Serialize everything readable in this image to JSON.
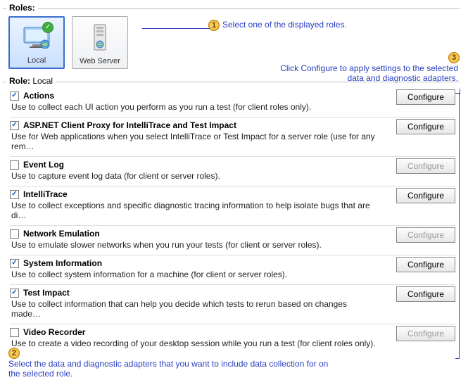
{
  "rolesHeader": "Roles:",
  "roles": [
    {
      "label": "Local",
      "selected": true
    },
    {
      "label": "Web Server",
      "selected": false
    }
  ],
  "roleDetailPrefix": "Role:",
  "roleDetailName": "Local",
  "adapters": [
    {
      "title": "Actions",
      "desc": "Use to collect each UI action you perform as you run a test (for client roles only).",
      "checked": true,
      "enabled": true
    },
    {
      "title": "ASP.NET Client Proxy for IntelliTrace and Test Impact",
      "desc": "Use for Web applications when you select IntelliTrace or Test Impact for a server role (use for any rem…",
      "checked": true,
      "enabled": true
    },
    {
      "title": "Event Log",
      "desc": "Use to capture event log data (for client or server roles).",
      "checked": false,
      "enabled": false
    },
    {
      "title": "IntelliTrace",
      "desc": "Use to collect exceptions and specific diagnostic tracing information to help isolate bugs that are di…",
      "checked": true,
      "enabled": true
    },
    {
      "title": "Network Emulation",
      "desc": "Use to emulate slower networks when you run your tests (for client or server roles).",
      "checked": false,
      "enabled": false
    },
    {
      "title": "System Information",
      "desc": "Use to collect system information for a machine (for client or server roles).",
      "checked": true,
      "enabled": true
    },
    {
      "title": "Test Impact",
      "desc": "Use to collect information that can help you decide which tests to rerun based on changes made…",
      "checked": true,
      "enabled": true
    },
    {
      "title": "Video Recorder",
      "desc": "Use to create a video recording of your desktop session while you run a test (for client roles only).",
      "checked": false,
      "enabled": false
    }
  ],
  "configureLabel": "Configure",
  "annotations": {
    "a1": "Select one of the displayed roles.",
    "a2": "Select the data and diagnostic adapters that you want to include data collection for on the selected role.",
    "a3a": "Click Configure to apply settings to the selected",
    "a3b": "data and diagnostic adapters."
  }
}
